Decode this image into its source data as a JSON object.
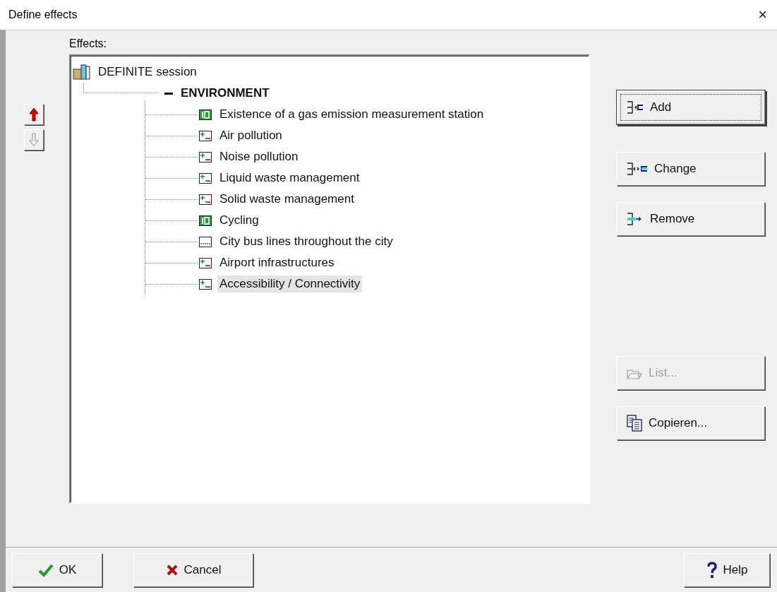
{
  "window": {
    "title": "Define effects",
    "close": "×"
  },
  "effects_label": "Effects:",
  "move_buttons": [
    {
      "kind": "up",
      "disabled": false
    },
    {
      "kind": "down",
      "disabled": true
    }
  ],
  "tree": {
    "label": "DEFINITE session",
    "children": [
      {
        "label": "ENVIRONMENT",
        "expanded": true,
        "children": [
          {
            "label": "Existence of a gas emission measurement station",
            "kind": "number",
            "selected": false
          },
          {
            "label": "Air pollution",
            "kind": "plusminus",
            "selected": false
          },
          {
            "label": "Noise pollution",
            "kind": "plusminus",
            "selected": false
          },
          {
            "label": "Liquid waste management",
            "kind": "plusminus",
            "selected": false
          },
          {
            "label": "Solid waste management",
            "kind": "plusminus",
            "selected": false
          },
          {
            "label": "Cycling",
            "kind": "number",
            "selected": false
          },
          {
            "label": "City bus lines throughout the city",
            "kind": "line",
            "selected": false
          },
          {
            "label": "Airport infrastructures",
            "kind": "plusminus",
            "selected": false
          },
          {
            "label": "Accessibility / Connectivity",
            "kind": "plusminus",
            "selected": true
          }
        ]
      }
    ]
  },
  "side_buttons": [
    {
      "label": "Add",
      "kind": "add",
      "disabled": false,
      "default": true
    },
    {
      "label": "Change",
      "kind": "change",
      "disabled": false,
      "default": false
    },
    {
      "label": "Remove",
      "kind": "remove",
      "disabled": false,
      "default": false
    },
    {
      "label": "List...",
      "kind": "list",
      "disabled": true,
      "default": false
    },
    {
      "label": "Copieren...",
      "kind": "copy",
      "disabled": false,
      "default": false
    }
  ],
  "footer_buttons": [
    {
      "label": "OK",
      "kind": "ok"
    },
    {
      "label": "Cancel",
      "kind": "cancel"
    },
    {
      "label": "Help",
      "kind": "help"
    }
  ]
}
